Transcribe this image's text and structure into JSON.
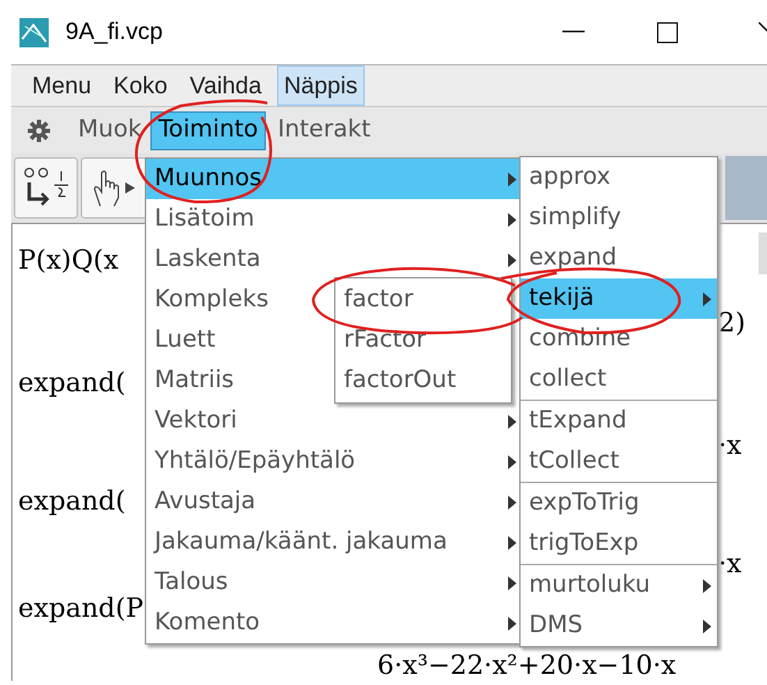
{
  "window": {
    "title": "9A_fi.vcp"
  },
  "menu_bar": [
    {
      "label": "Menu",
      "selected": false
    },
    {
      "label": "Koko",
      "selected": false
    },
    {
      "label": "Vaihda",
      "selected": false
    },
    {
      "label": "Näppis",
      "selected": true
    }
  ],
  "toolbar_menus": [
    {
      "label": "Muok",
      "selected": false
    },
    {
      "label": "Toiminto",
      "selected": true
    },
    {
      "label": "Interakt",
      "selected": false
    }
  ],
  "work_area": {
    "left_lines": [
      "P(x)Q(x",
      "expand(",
      "expand(",
      "expand(P"
    ],
    "right_lines": [
      "2)",
      "·x",
      "·x"
    ],
    "bottom_line": "6·x³−22·x²+20·x−10·x"
  },
  "menu": {
    "items": [
      {
        "label": "Muunnos",
        "selected": true,
        "has_submenu": true
      },
      {
        "label": "Lisätoim",
        "selected": false,
        "has_submenu": true
      },
      {
        "label": "Laskenta",
        "selected": false,
        "has_submenu": true
      },
      {
        "label": "Kompleks",
        "selected": false,
        "has_submenu": false
      },
      {
        "label": "Luett",
        "selected": false,
        "has_submenu": false
      },
      {
        "label": "Matriis",
        "selected": false,
        "has_submenu": false
      },
      {
        "label": "Vektori",
        "selected": false,
        "has_submenu": true
      },
      {
        "label": "Yhtälö/Epäyhtälö",
        "selected": false,
        "has_submenu": true
      },
      {
        "label": "Avustaja",
        "selected": false,
        "has_submenu": true
      },
      {
        "label": "Jakauma/käänt. jakauma",
        "selected": false,
        "has_submenu": true
      },
      {
        "label": "Talous",
        "selected": false,
        "has_submenu": true
      },
      {
        "label": "Komento",
        "selected": false,
        "has_submenu": true
      }
    ]
  },
  "submenu": {
    "groups": [
      [
        {
          "label": "approx",
          "selected": false,
          "has_submenu": false
        },
        {
          "label": "simplify",
          "selected": false,
          "has_submenu": false
        },
        {
          "label": "expand",
          "selected": false,
          "has_submenu": false
        },
        {
          "label": "tekijä",
          "selected": true,
          "has_submenu": true
        },
        {
          "label": "combine",
          "selected": false,
          "has_submenu": false
        },
        {
          "label": "collect",
          "selected": false,
          "has_submenu": false
        }
      ],
      [
        {
          "label": "tExpand",
          "selected": false,
          "has_submenu": false
        },
        {
          "label": "tCollect",
          "selected": false,
          "has_submenu": false
        }
      ],
      [
        {
          "label": "expToTrig",
          "selected": false,
          "has_submenu": false
        },
        {
          "label": "trigToExp",
          "selected": false,
          "has_submenu": false
        }
      ],
      [
        {
          "label": "murtoluku",
          "selected": false,
          "has_submenu": true
        },
        {
          "label": "DMS",
          "selected": false,
          "has_submenu": true
        }
      ]
    ]
  },
  "factor_menu": {
    "items": [
      "factor",
      "rFactor",
      "factorOut"
    ]
  }
}
